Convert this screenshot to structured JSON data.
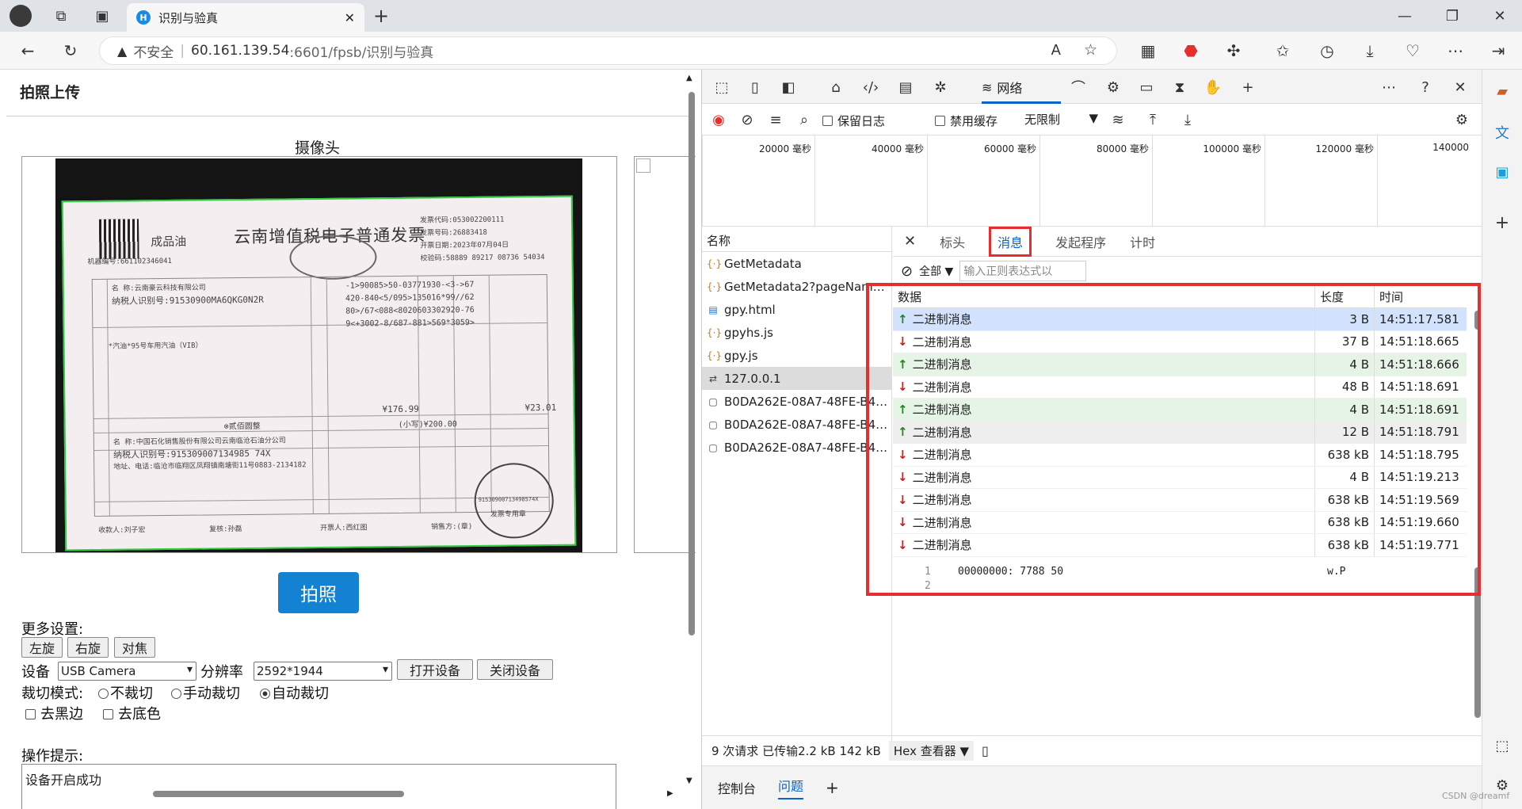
{
  "browser": {
    "tab_title": "识别与验真",
    "tab_icon_letter": "H",
    "new_tab": "+",
    "insecure_label": "不安全",
    "url_host": "60.161.139.54",
    "url_rest": ":6601/fpsb/识别与验真"
  },
  "page": {
    "section_title": "拍照上传",
    "camera_label": "摄像头",
    "photo_button": "拍照",
    "more_settings": "更多设置:",
    "rotate_left": "左旋",
    "rotate_right": "右旋",
    "focus": "对焦",
    "device_label": "设备",
    "device_value": "USB Camera",
    "resolution_label": "分辨率",
    "resolution_value": "2592*1944",
    "open_device": "打开设备",
    "close_device": "关闭设备",
    "crop_mode_label": "裁切模式:",
    "crop_none": "不裁切",
    "crop_manual": "手动裁切",
    "crop_auto": "自动裁切",
    "remove_black": "去黑边",
    "remove_bg": "去底色",
    "tips_label": "操作提示:",
    "tips_text": "设备开启成功"
  },
  "invoice": {
    "product": "成品油",
    "title": "云南增值税电子普通发票",
    "code_line": "发票代码:053002200111",
    "number_line": "发票号码:26883418",
    "date_line": "开票日期:2023年07月04日",
    "check_line": "校验码:58889 89217 08736 54034",
    "machine_line": "机器编号:661102346041",
    "buyer_name": "名    称:云南豪云科技有限公司",
    "buyer_tax": "纳税人识别号:91530900MA6QKG0N2R",
    "cipher1": "-1>90085>50-03771930-<3->67",
    "cipher2": "420-840<5/095>135016*99//62",
    "cipher3": "80>/67<088<8020603302920-76",
    "cipher4": "9<+3002-8/687-881>569*3059>",
    "item": "*汽油*95号车用汽油（VIB）",
    "total": "¥176.99",
    "tax": "¥23.01",
    "amount_words": "⊗贰佰圆整",
    "amount_small": "(小写)¥200.00",
    "seller_name": "名    称:中国石化销售股份有限公司云南临沧石油分公司",
    "seller_tax": "纳税人识别号:915309007134985 74X",
    "seller_addr": "地址、电话:临沧市临翔区凤翔镇南塘街11号0883-2134182",
    "payee": "收款人:刘子宏",
    "reviewer": "复核:孙磊",
    "drawer": "开票人:西红图",
    "seller_seal": "销售方:(章)",
    "seal_text": "91530900713498574X",
    "seal_label": "发票专用章"
  },
  "devtools": {
    "network_tab": "网络",
    "preserve_log": "保留日志",
    "disable_cache": "禁用缓存",
    "throttle": "无限制",
    "timeline": [
      "20000 毫秒",
      "40000 毫秒",
      "60000 毫秒",
      "80000 毫秒",
      "100000 毫秒",
      "120000 毫秒",
      "140000"
    ],
    "name_header": "名称",
    "requests": [
      {
        "name": "GetMetadata",
        "icon": "{·}"
      },
      {
        "name": "GetMetadata2?pageNam…",
        "icon": "{·}"
      },
      {
        "name": "gpy.html",
        "icon": "▤"
      },
      {
        "name": "gpyhs.js",
        "icon": "{·}"
      },
      {
        "name": "gpy.js",
        "icon": "{·}"
      },
      {
        "name": "127.0.0.1",
        "icon": "⇄"
      },
      {
        "name": "B0DA262E-08A7-48FE-B4…",
        "icon": "▢"
      },
      {
        "name": "B0DA262E-08A7-48FE-B4…",
        "icon": "▢"
      },
      {
        "name": "B0DA262E-08A7-48FE-B4…",
        "icon": "▢"
      }
    ],
    "detail_tabs": {
      "headers": "标头",
      "messages": "消息",
      "initiator": "发起程序",
      "timing": "计时"
    },
    "filter_all": "全部",
    "filter_placeholder": "输入正则表达式以",
    "col_data": "数据",
    "col_length": "长度",
    "col_time": "时间",
    "messages": [
      {
        "dir": "up",
        "text": "二进制消息",
        "len": "3 B",
        "time": "14:51:17.581"
      },
      {
        "dir": "down",
        "text": "二进制消息",
        "len": "37 B",
        "time": "14:51:18.665"
      },
      {
        "dir": "up",
        "text": "二进制消息",
        "len": "4 B",
        "time": "14:51:18.666"
      },
      {
        "dir": "down",
        "text": "二进制消息",
        "len": "48 B",
        "time": "14:51:18.691"
      },
      {
        "dir": "up",
        "text": "二进制消息",
        "len": "4 B",
        "time": "14:51:18.691"
      },
      {
        "dir": "up",
        "text": "二进制消息",
        "len": "12 B",
        "time": "14:51:18.791"
      },
      {
        "dir": "down",
        "text": "二进制消息",
        "len": "638 kB",
        "time": "14:51:18.795"
      },
      {
        "dir": "down",
        "text": "二进制消息",
        "len": "4 B",
        "time": "14:51:19.213"
      },
      {
        "dir": "down",
        "text": "二进制消息",
        "len": "638 kB",
        "time": "14:51:19.569"
      },
      {
        "dir": "down",
        "text": "二进制消息",
        "len": "638 kB",
        "time": "14:51:19.660"
      },
      {
        "dir": "down",
        "text": "二进制消息",
        "len": "638 kB",
        "time": "14:51:19.771"
      }
    ],
    "hex_line_no": "1",
    "hex_line_no2": "2",
    "hex_content": "00000000: 7788 50",
    "hex_ascii": "w.P",
    "status": "9 次请求  已传输2.2 kB  142 kB",
    "hex_viewer": "Hex 查看器",
    "console_tab": "控制台",
    "issues_tab": "问题",
    "watermark": "CSDN @dreamf",
    "colors": {
      "red_box": "#e62e2e",
      "accent": "#0b63c7",
      "photo_button": "#1482d3",
      "up_row": "#e6f4e6",
      "selected_row": "#d3e3fd"
    }
  }
}
